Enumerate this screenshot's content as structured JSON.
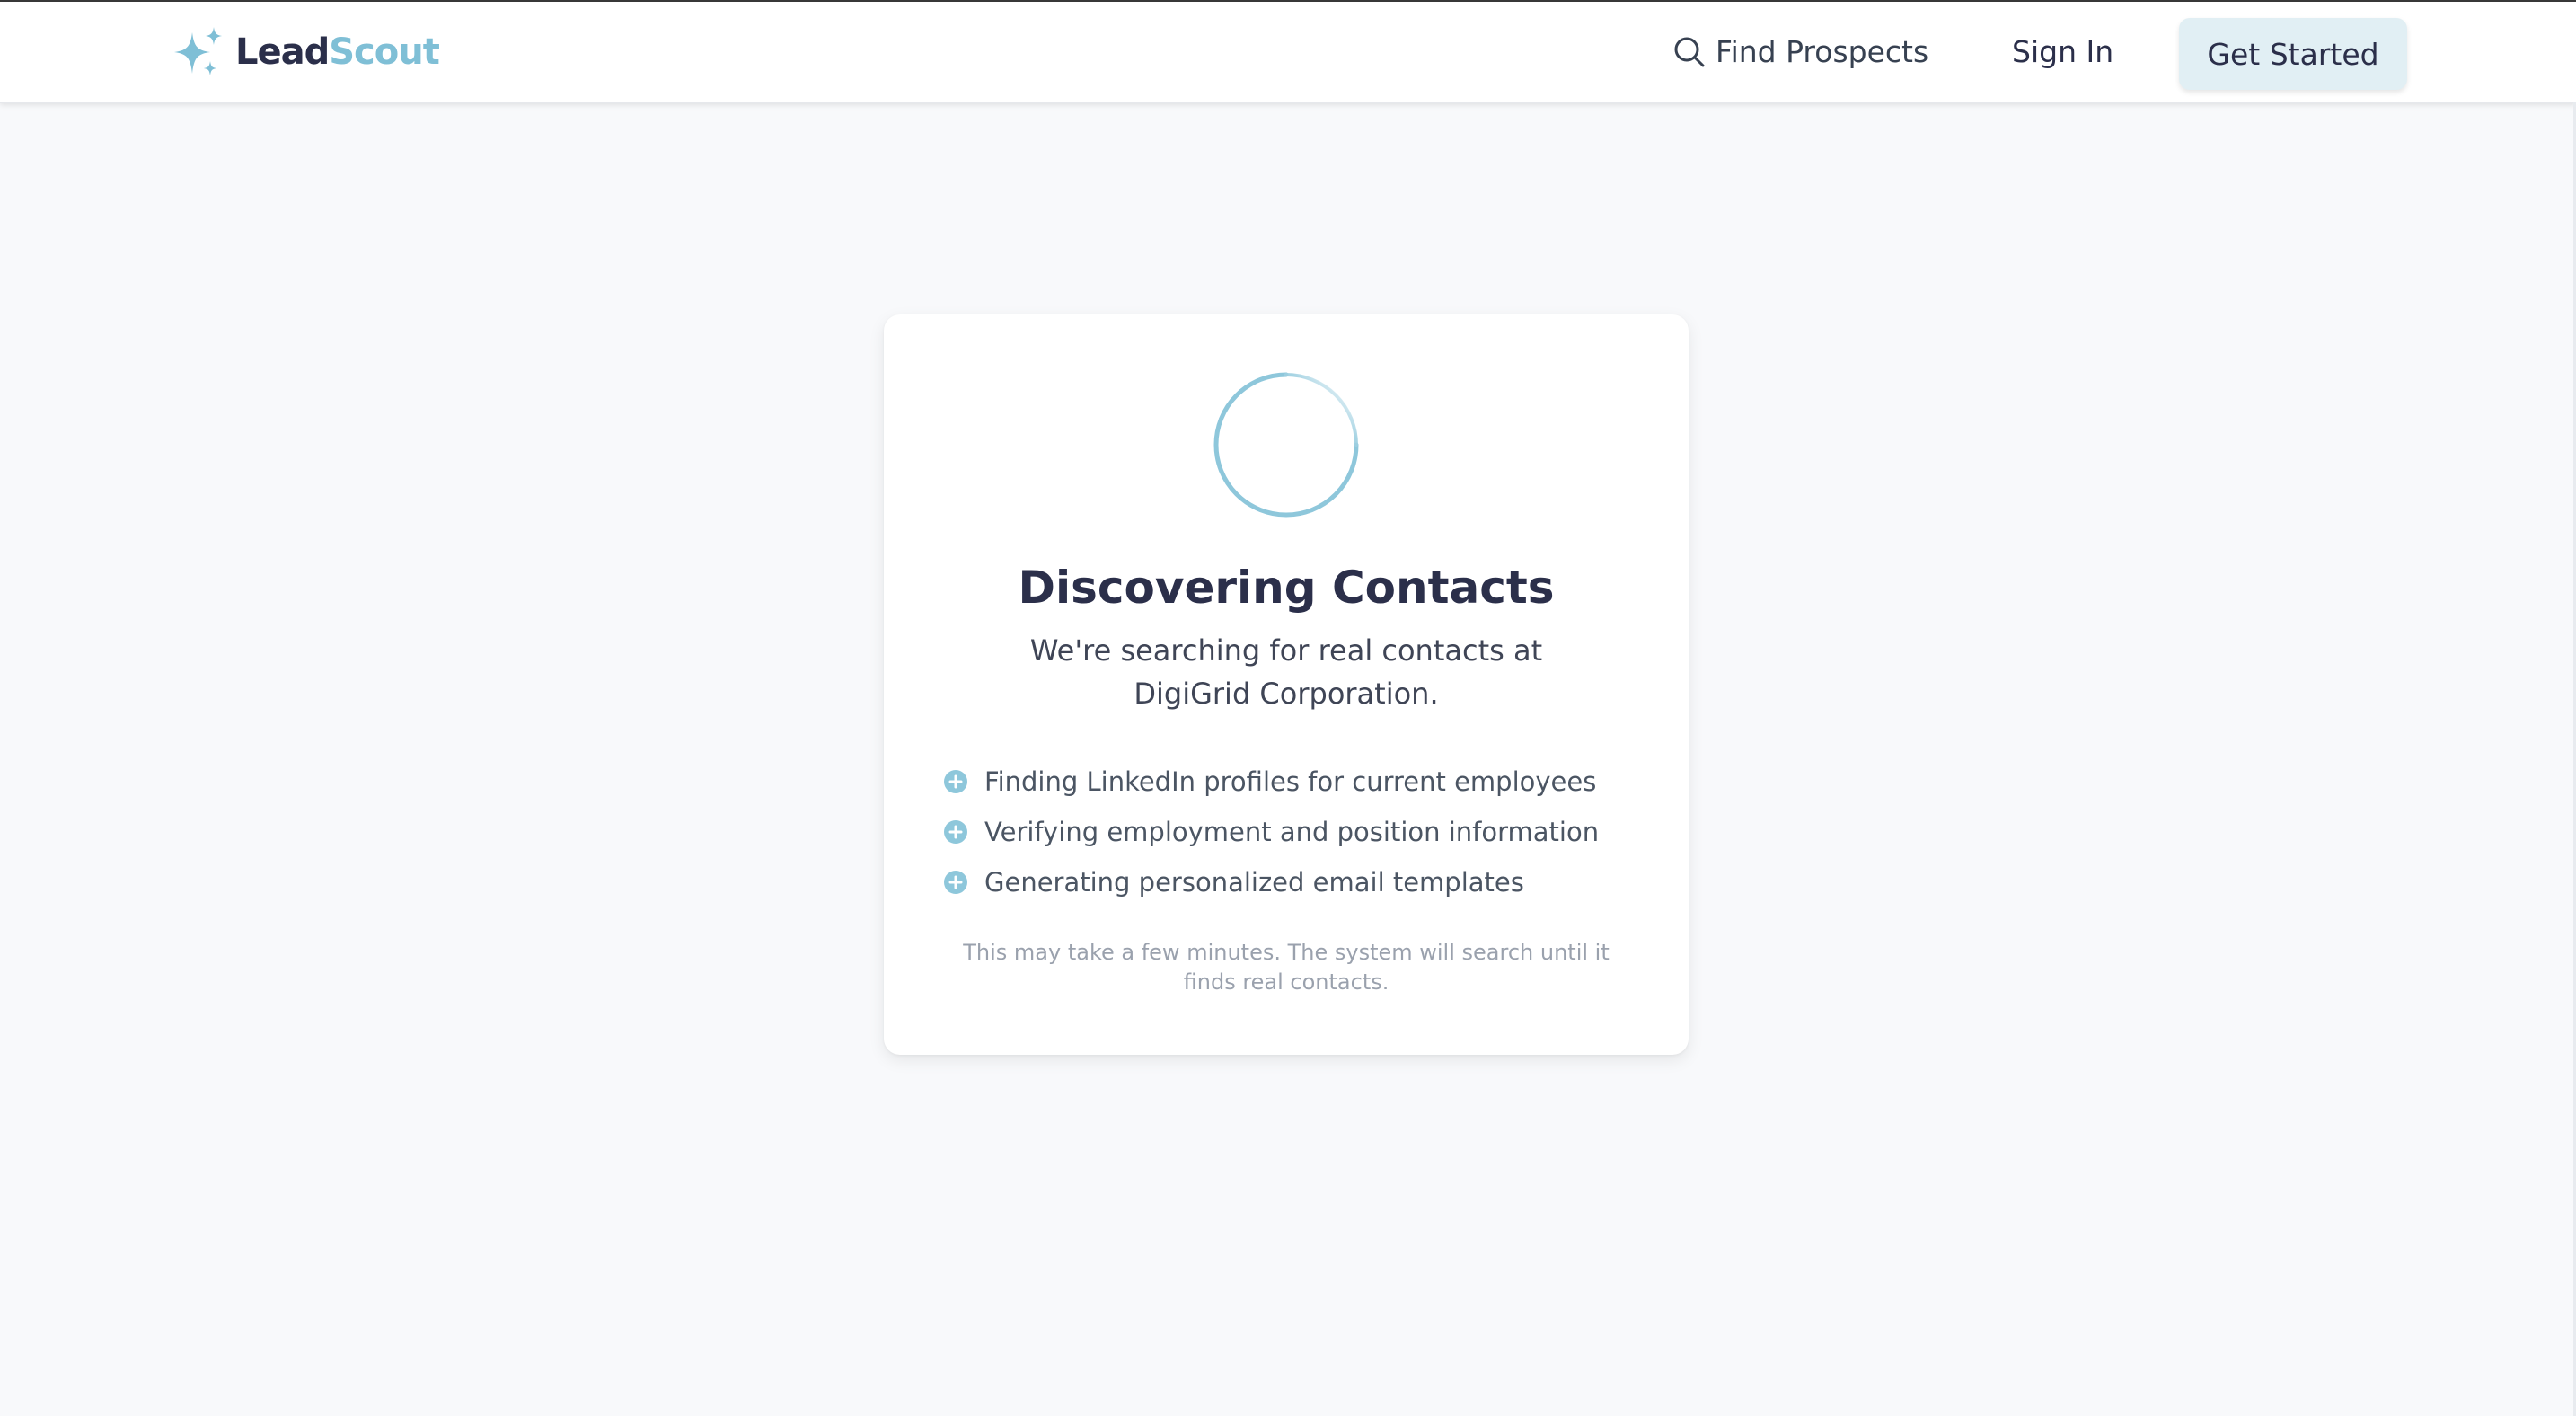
{
  "header": {
    "brand": {
      "part1": "Lead",
      "part2": "Scout",
      "icon": "sparkles-icon"
    },
    "nav": {
      "find_prospects": {
        "label": "Find Prospects",
        "icon": "search-icon"
      },
      "sign_in": "Sign In",
      "get_started": "Get Started"
    }
  },
  "status_card": {
    "spinner": "loading-spinner",
    "title": "Discovering Contacts",
    "subtitle": "We're searching for real contacts at DigiGrid Corporation.",
    "steps": [
      "Finding LinkedIn profiles for current employees",
      "Verifying employment and position information",
      "Generating personalized email templates"
    ],
    "note": "This may take a few minutes. The system will search until it finds real contacts."
  },
  "colors": {
    "brand_dark": "#2b2f4a",
    "brand_accent": "#7fbfd6",
    "button_bg": "#e1eff4",
    "page_bg": "#f8f9fb"
  }
}
